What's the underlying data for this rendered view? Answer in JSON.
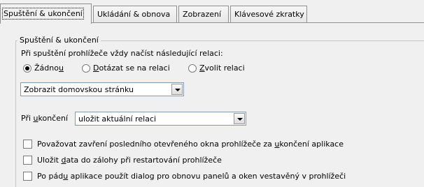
{
  "tabs": [
    {
      "label": "Spuštění & ukončení",
      "active": true
    },
    {
      "label": "Ukládání & obnova",
      "active": false
    },
    {
      "label": "Zobrazení",
      "active": false
    },
    {
      "label": "Klávesové zkratky",
      "active": false
    }
  ],
  "group": {
    "legend": "Spuštění & ukončení",
    "startup_label": "Při spuštění prohlížeče vždy načíst následující relaci:",
    "radios": [
      {
        "pre": "Žádno",
        "ul": "u",
        "post": "",
        "checked": true
      },
      {
        "pre": "",
        "ul": "D",
        "post": "otázat se na relaci",
        "checked": false
      },
      {
        "pre": "",
        "ul": "Z",
        "post": "volit relaci",
        "checked": false
      }
    ],
    "homepage_select": "Zobrazit domovskou stránku",
    "exit_label_pre": "Při ",
    "exit_label_ul": "u",
    "exit_label_post": "končení",
    "exit_select": "uložit aktuální relaci",
    "checkboxes": [
      {
        "pre": "Považovat zavření posledního otevřeného okna prohlížeče za ",
        "ul": "u",
        "post": "končení aplikace",
        "checked": false
      },
      {
        "pre": "Uložit ",
        "ul": "d",
        "post": "ata do zálohy při restartování prohlížeče",
        "checked": false
      },
      {
        "pre": "Po pád",
        "ul": "u",
        "post": " aplikace použít dialog pro obnovu panelů a oken vestavěný v prohlížeči",
        "checked": false
      }
    ]
  }
}
